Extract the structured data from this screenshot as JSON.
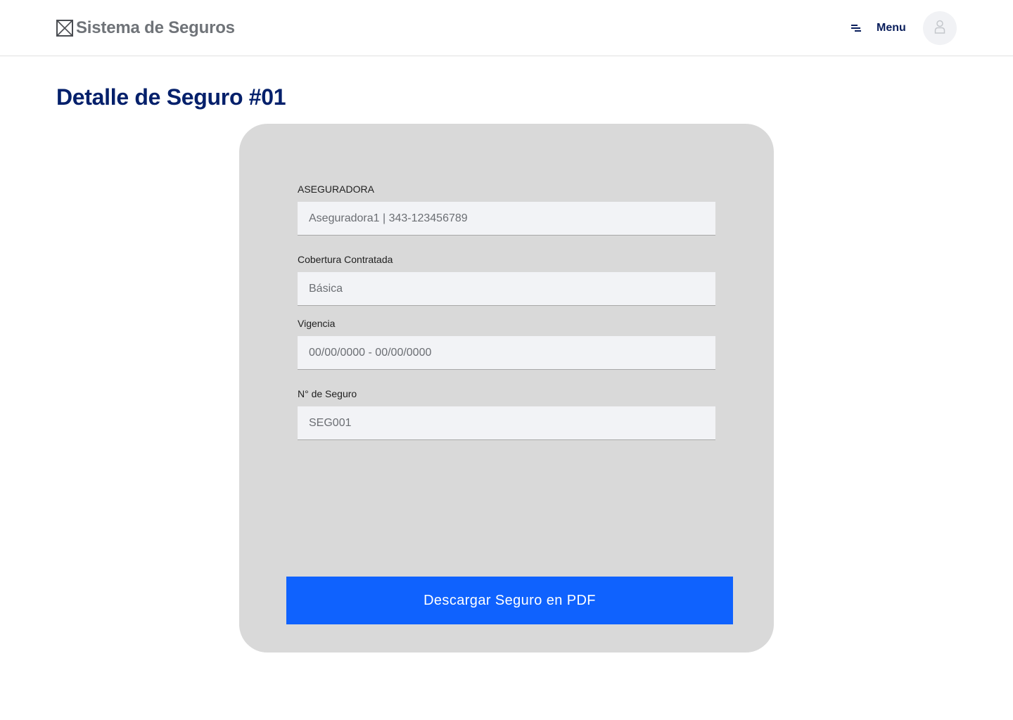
{
  "header": {
    "brand_title": "Sistema de Seguros",
    "brand_icon": "image-placeholder-icon",
    "menu_label": "Menu",
    "menu_icon": "hamburger-menu-icon",
    "avatar_icon": "user-icon"
  },
  "page": {
    "title": "Detalle de Seguro #01"
  },
  "form": {
    "fields": [
      {
        "label": "ASEGURADORA",
        "value": "Aseguradora1 | 343-123456789"
      },
      {
        "label": "Cobertura Contratada",
        "value": "Básica"
      },
      {
        "label": "Vigencia",
        "value": "00/00/0000 - 00/00/0000"
      },
      {
        "label": "N° de Seguro",
        "value": "SEG001"
      }
    ],
    "download_label": "Descargar Seguro en PDF"
  },
  "colors": {
    "primary": "#0f62fe",
    "title": "#04206b",
    "card_bg": "#d9d9d9",
    "input_bg": "#f2f3f6"
  }
}
